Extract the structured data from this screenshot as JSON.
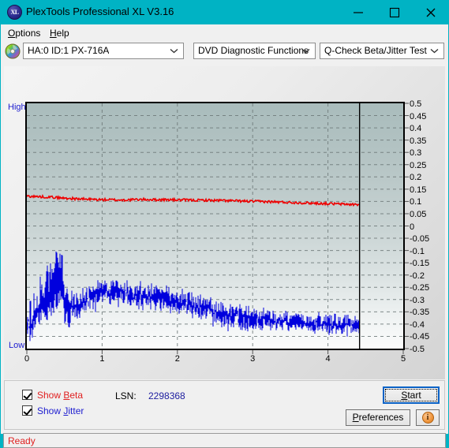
{
  "window": {
    "title": "PlexTools Professional XL V3.16",
    "icon_label": "XL",
    "accent_color": "#00b3c4",
    "controls": {
      "minimize": "minimize-icon",
      "maximize": "maximize-icon",
      "close": "close-icon"
    }
  },
  "menubar": {
    "items": [
      {
        "label": "Options",
        "accel": "O"
      },
      {
        "label": "Help",
        "accel": "H"
      }
    ]
  },
  "toolbar": {
    "drive_icon": "disc-icon",
    "drive_select": {
      "value": "HA:0 ID:1  PX-716A"
    },
    "function_select": {
      "value": "DVD Diagnostic Functions"
    },
    "test_select": {
      "value": "Q-Check Beta/Jitter Test"
    }
  },
  "chart_data": {
    "type": "line",
    "title": "",
    "xlabel": "",
    "ylabel": "",
    "xlim": [
      0,
      5
    ],
    "ylim": [
      -0.5,
      0.5
    ],
    "xticks": [
      "0",
      "1",
      "2",
      "3",
      "4",
      "5"
    ],
    "yticks": [
      "0.5",
      "0.45",
      "0.4",
      "0.35",
      "0.3",
      "0.25",
      "0.2",
      "0.15",
      "0.1",
      "0.05",
      "0",
      "-0.05",
      "-0.1",
      "-0.15",
      "-0.2",
      "-0.25",
      "-0.3",
      "-0.35",
      "-0.4",
      "-0.45",
      "-0.5"
    ],
    "axis_top_label": "High",
    "axis_bottom_label": "Low",
    "grid": true,
    "grid_style": "dashed",
    "data_end_marker_x": 4.42,
    "series": [
      {
        "name": "Beta",
        "color": "#ee0000",
        "x": [
          0.02,
          0.1,
          0.2,
          0.3,
          0.4,
          0.5,
          0.6,
          0.7,
          0.8,
          0.9,
          1.0,
          1.1,
          1.2,
          1.3,
          1.4,
          1.5,
          1.6,
          1.7,
          1.8,
          1.9,
          2.0,
          2.1,
          2.2,
          2.3,
          2.4,
          2.5,
          2.6,
          2.7,
          2.8,
          2.9,
          3.0,
          3.1,
          3.2,
          3.3,
          3.4,
          3.5,
          3.6,
          3.7,
          3.8,
          3.9,
          4.0,
          4.1,
          4.2,
          4.3,
          4.42
        ],
        "values": [
          0.122,
          0.12,
          0.119,
          0.118,
          0.116,
          0.113,
          0.112,
          0.11,
          0.109,
          0.108,
          0.107,
          0.107,
          0.106,
          0.106,
          0.107,
          0.108,
          0.108,
          0.107,
          0.107,
          0.107,
          0.106,
          0.106,
          0.105,
          0.105,
          0.105,
          0.104,
          0.104,
          0.103,
          0.102,
          0.101,
          0.1,
          0.1,
          0.099,
          0.098,
          0.097,
          0.096,
          0.095,
          0.094,
          0.093,
          0.092,
          0.091,
          0.09,
          0.089,
          0.088,
          0.087
        ]
      },
      {
        "name": "Jitter",
        "color": "#0000dd",
        "x": [
          0.02,
          0.06,
          0.1,
          0.14,
          0.18,
          0.22,
          0.26,
          0.3,
          0.34,
          0.38,
          0.42,
          0.46,
          0.5,
          0.56,
          0.62,
          0.7,
          0.8,
          0.9,
          1.0,
          1.1,
          1.2,
          1.3,
          1.4,
          1.5,
          1.6,
          1.7,
          1.8,
          1.9,
          2.0,
          2.1,
          2.2,
          2.3,
          2.4,
          2.5,
          2.6,
          2.7,
          2.8,
          2.9,
          3.0,
          3.1,
          3.2,
          3.3,
          3.4,
          3.5,
          3.6,
          3.7,
          3.8,
          3.9,
          4.0,
          4.1,
          4.2,
          4.3,
          4.42
        ],
        "values": [
          -0.3,
          -0.27,
          -0.235,
          -0.21,
          -0.19,
          -0.175,
          -0.165,
          -0.15,
          -0.145,
          -0.14,
          -0.135,
          -0.138,
          -0.33,
          -0.345,
          -0.33,
          -0.315,
          -0.3,
          -0.285,
          -0.275,
          -0.268,
          -0.27,
          -0.275,
          -0.28,
          -0.285,
          -0.29,
          -0.295,
          -0.3,
          -0.305,
          -0.31,
          -0.318,
          -0.325,
          -0.335,
          -0.345,
          -0.355,
          -0.362,
          -0.368,
          -0.372,
          -0.375,
          -0.378,
          -0.38,
          -0.382,
          -0.384,
          -0.386,
          -0.388,
          -0.39,
          -0.392,
          -0.394,
          -0.396,
          -0.398,
          -0.4,
          -0.402,
          -0.404,
          -0.405
        ],
        "noise_band": 0.055,
        "note": "Dense noisy band; early segment 0-0.47 oscillates between -0.40 and -0.08, drops at 0.48"
      }
    ]
  },
  "controls": {
    "show_beta": {
      "label": "Show Beta",
      "accel": "B",
      "checked": true,
      "color": "#e02020"
    },
    "show_jitter": {
      "label": "Show Jitter",
      "accel": "J",
      "checked": true,
      "color": "#2020d0"
    },
    "lsn_label": "LSN:",
    "lsn_value": "2298368",
    "start_button": {
      "label": "Start",
      "accel": "S"
    },
    "preferences_button": {
      "label": "Preferences",
      "accel": "P"
    },
    "info_button": {
      "label": "i"
    }
  },
  "statusbar": {
    "text": "Ready"
  }
}
